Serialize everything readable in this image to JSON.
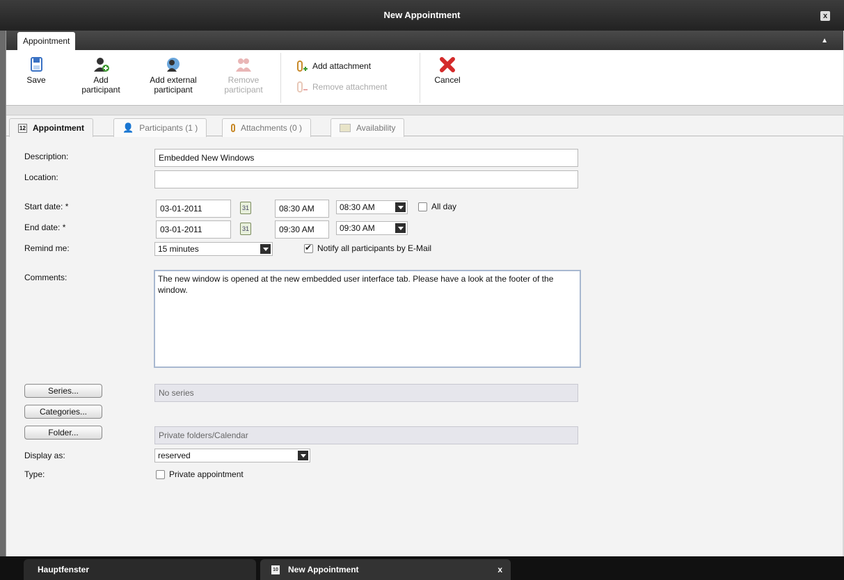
{
  "window": {
    "title": "New Appointment",
    "close": "x"
  },
  "ribbon": {
    "tab": "Appointment",
    "collapse": "▲"
  },
  "toolbar": {
    "save": "Save",
    "add_participant": [
      "Add",
      "participant"
    ],
    "add_external": [
      "Add external",
      "participant"
    ],
    "remove_participant": [
      "Remove",
      "participant"
    ],
    "add_attachment": "Add attachment",
    "remove_attachment": "Remove attachment",
    "cancel": "Cancel"
  },
  "tabs": [
    {
      "label": "Appointment"
    },
    {
      "label": "Participants (1 )"
    },
    {
      "label": "Attachments (0 )"
    },
    {
      "label": "Availability"
    }
  ],
  "form": {
    "description_label": "Description:",
    "description_value": "Embedded New Windows",
    "location_label": "Location:",
    "location_value": "",
    "start_label": "Start date: *",
    "start_date": "03-01-2011",
    "start_time": "08:30 AM",
    "start_time_select": "08:30 AM",
    "all_day": "All day",
    "end_label": "End date: *",
    "end_date": "03-01-2011",
    "end_time": "09:30 AM",
    "end_time_select": "09:30 AM",
    "remind_label": "Remind me:",
    "remind_value": "15 minutes",
    "notify": "Notify all participants by E-Mail",
    "comments_label": "Comments:",
    "comments_value": "The new window is opened at the new embedded user interface tab. Please have a look at the footer of the window.",
    "series_btn": "Series...",
    "series_value": "No series",
    "categories_btn": "Categories...",
    "folder_btn": "Folder...",
    "folder_value": "Private folders/Calendar",
    "display_label": "Display as:",
    "display_value": "reserved",
    "type_label": "Type:",
    "private": "Private appointment"
  },
  "taskbar": {
    "main": "Hauptfenster",
    "current": "New Appointment",
    "current_close": "x"
  }
}
